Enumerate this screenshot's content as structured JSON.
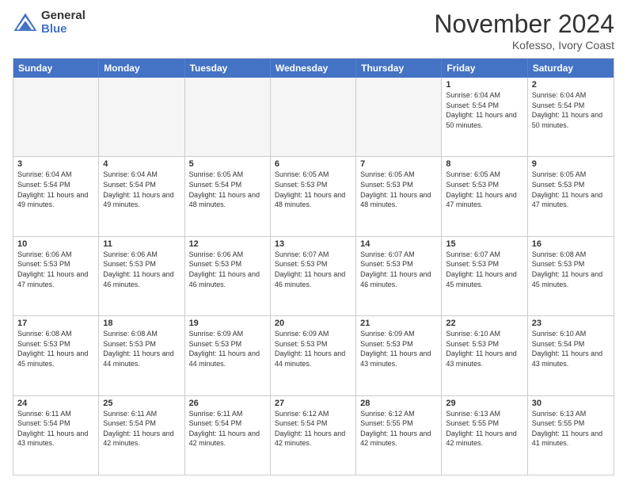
{
  "logo": {
    "general": "General",
    "blue": "Blue"
  },
  "header": {
    "month": "November 2024",
    "location": "Kofesso, Ivory Coast"
  },
  "weekdays": [
    "Sunday",
    "Monday",
    "Tuesday",
    "Wednesday",
    "Thursday",
    "Friday",
    "Saturday"
  ],
  "rows": [
    [
      {
        "day": "",
        "empty": true
      },
      {
        "day": "",
        "empty": true
      },
      {
        "day": "",
        "empty": true
      },
      {
        "day": "",
        "empty": true
      },
      {
        "day": "",
        "empty": true
      },
      {
        "day": "1",
        "sunrise": "6:04 AM",
        "sunset": "5:54 PM",
        "daylight": "11 hours and 50 minutes."
      },
      {
        "day": "2",
        "sunrise": "6:04 AM",
        "sunset": "5:54 PM",
        "daylight": "11 hours and 50 minutes."
      }
    ],
    [
      {
        "day": "3",
        "sunrise": "6:04 AM",
        "sunset": "5:54 PM",
        "daylight": "11 hours and 49 minutes."
      },
      {
        "day": "4",
        "sunrise": "6:04 AM",
        "sunset": "5:54 PM",
        "daylight": "11 hours and 49 minutes."
      },
      {
        "day": "5",
        "sunrise": "6:05 AM",
        "sunset": "5:54 PM",
        "daylight": "11 hours and 48 minutes."
      },
      {
        "day": "6",
        "sunrise": "6:05 AM",
        "sunset": "5:53 PM",
        "daylight": "11 hours and 48 minutes."
      },
      {
        "day": "7",
        "sunrise": "6:05 AM",
        "sunset": "5:53 PM",
        "daylight": "11 hours and 48 minutes."
      },
      {
        "day": "8",
        "sunrise": "6:05 AM",
        "sunset": "5:53 PM",
        "daylight": "11 hours and 47 minutes."
      },
      {
        "day": "9",
        "sunrise": "6:05 AM",
        "sunset": "5:53 PM",
        "daylight": "11 hours and 47 minutes."
      }
    ],
    [
      {
        "day": "10",
        "sunrise": "6:06 AM",
        "sunset": "5:53 PM",
        "daylight": "11 hours and 47 minutes."
      },
      {
        "day": "11",
        "sunrise": "6:06 AM",
        "sunset": "5:53 PM",
        "daylight": "11 hours and 46 minutes."
      },
      {
        "day": "12",
        "sunrise": "6:06 AM",
        "sunset": "5:53 PM",
        "daylight": "11 hours and 46 minutes."
      },
      {
        "day": "13",
        "sunrise": "6:07 AM",
        "sunset": "5:53 PM",
        "daylight": "11 hours and 46 minutes."
      },
      {
        "day": "14",
        "sunrise": "6:07 AM",
        "sunset": "5:53 PM",
        "daylight": "11 hours and 46 minutes."
      },
      {
        "day": "15",
        "sunrise": "6:07 AM",
        "sunset": "5:53 PM",
        "daylight": "11 hours and 45 minutes."
      },
      {
        "day": "16",
        "sunrise": "6:08 AM",
        "sunset": "5:53 PM",
        "daylight": "11 hours and 45 minutes."
      }
    ],
    [
      {
        "day": "17",
        "sunrise": "6:08 AM",
        "sunset": "5:53 PM",
        "daylight": "11 hours and 45 minutes."
      },
      {
        "day": "18",
        "sunrise": "6:08 AM",
        "sunset": "5:53 PM",
        "daylight": "11 hours and 44 minutes."
      },
      {
        "day": "19",
        "sunrise": "6:09 AM",
        "sunset": "5:53 PM",
        "daylight": "11 hours and 44 minutes."
      },
      {
        "day": "20",
        "sunrise": "6:09 AM",
        "sunset": "5:53 PM",
        "daylight": "11 hours and 44 minutes."
      },
      {
        "day": "21",
        "sunrise": "6:09 AM",
        "sunset": "5:53 PM",
        "daylight": "11 hours and 43 minutes."
      },
      {
        "day": "22",
        "sunrise": "6:10 AM",
        "sunset": "5:53 PM",
        "daylight": "11 hours and 43 minutes."
      },
      {
        "day": "23",
        "sunrise": "6:10 AM",
        "sunset": "5:54 PM",
        "daylight": "11 hours and 43 minutes."
      }
    ],
    [
      {
        "day": "24",
        "sunrise": "6:11 AM",
        "sunset": "5:54 PM",
        "daylight": "11 hours and 43 minutes."
      },
      {
        "day": "25",
        "sunrise": "6:11 AM",
        "sunset": "5:54 PM",
        "daylight": "11 hours and 42 minutes."
      },
      {
        "day": "26",
        "sunrise": "6:11 AM",
        "sunset": "5:54 PM",
        "daylight": "11 hours and 42 minutes."
      },
      {
        "day": "27",
        "sunrise": "6:12 AM",
        "sunset": "5:54 PM",
        "daylight": "11 hours and 42 minutes."
      },
      {
        "day": "28",
        "sunrise": "6:12 AM",
        "sunset": "5:55 PM",
        "daylight": "11 hours and 42 minutes."
      },
      {
        "day": "29",
        "sunrise": "6:13 AM",
        "sunset": "5:55 PM",
        "daylight": "11 hours and 42 minutes."
      },
      {
        "day": "30",
        "sunrise": "6:13 AM",
        "sunset": "5:55 PM",
        "daylight": "11 hours and 41 minutes."
      }
    ]
  ]
}
